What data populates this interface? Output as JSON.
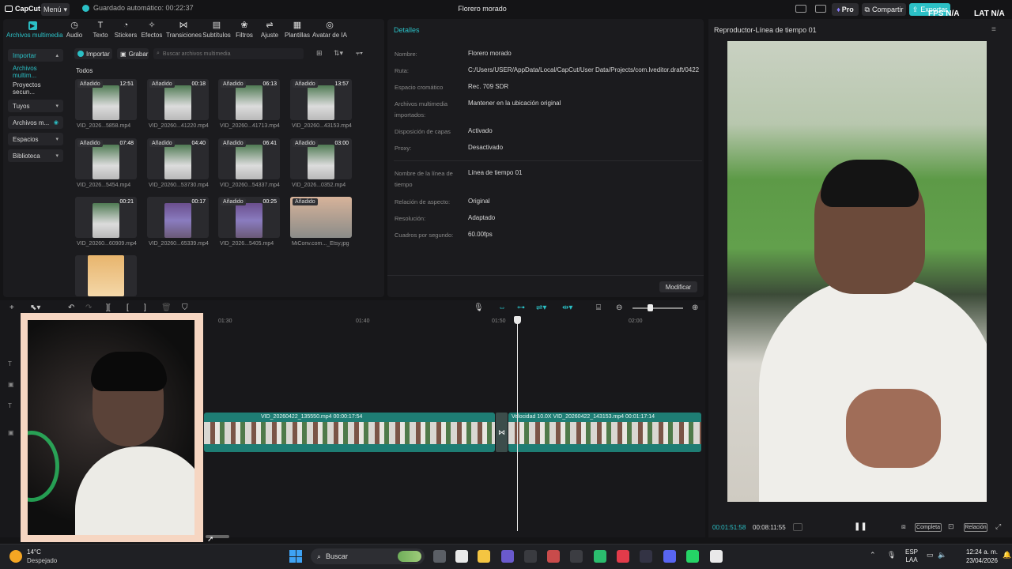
{
  "topbar": {
    "logo": "CapCut",
    "menu": "Menú",
    "autosave": "Guardado automático: 00:22:37",
    "project_title": "Florero morado",
    "pro": "Pro",
    "share": "Compartir",
    "export": "Exportar",
    "fps": "FPS N/A",
    "lat": "LAT N/A"
  },
  "toolbar": {
    "tools": [
      "Archivos multimedia",
      "Audio",
      "Texto",
      "Stickers",
      "Efectos",
      "Transiciones",
      "Subtítulos",
      "Filtros",
      "Ajuste",
      "Plantillas",
      "Avatar de IA"
    ],
    "icons": [
      "media-icon",
      "audio-icon",
      "text-icon",
      "stickers-icon",
      "effects-icon",
      "transitions-icon",
      "subtitles-icon",
      "filters-icon",
      "adjust-icon",
      "templates-icon",
      "ai-avatar-icon"
    ]
  },
  "sidebar": {
    "items": [
      "Importar",
      "Archivos multim...",
      "Proyectos secun...",
      "Tuyos",
      "Archivos m...",
      "Espacios",
      "Biblioteca"
    ]
  },
  "media": {
    "import": "Importar",
    "record": "Grabar",
    "search_placeholder": "Buscar archivos multimedia",
    "filter_all": "Todos",
    "items": [
      {
        "badge": "Añadido",
        "duration": "12:51",
        "name": "VID_2026...5858.mp4"
      },
      {
        "badge": "Añadido",
        "duration": "00:18",
        "name": "VID_20260...41220.mp4"
      },
      {
        "badge": "Añadido",
        "duration": "06:13",
        "name": "VID_20260...41713.mp4"
      },
      {
        "badge": "Añadido",
        "duration": "13:57",
        "name": "VID_20260...43153.mp4"
      },
      {
        "badge": "Añadido",
        "duration": "07:48",
        "name": "VID_2026...5454.mp4"
      },
      {
        "badge": "Añadido",
        "duration": "04:40",
        "name": "VID_20260...53730.mp4"
      },
      {
        "badge": "Añadido",
        "duration": "06:41",
        "name": "VID_20260...54337.mp4"
      },
      {
        "badge": "Añadido",
        "duration": "03:00",
        "name": "VID_2026...0352.mp4"
      },
      {
        "badge": "",
        "duration": "00:21",
        "name": "VID_20260...60909.mp4"
      },
      {
        "badge": "",
        "duration": "00:17",
        "name": "VID_20260...65339.mp4"
      },
      {
        "badge": "Añadido",
        "duration": "00:25",
        "name": "VID_2026...5405.mp4"
      },
      {
        "badge": "Añadido",
        "duration": "",
        "name": "MiConv.com..._Etsy.jpg"
      },
      {
        "badge": "",
        "duration": "",
        "name": ""
      }
    ]
  },
  "details": {
    "title": "Detalles",
    "rows": [
      {
        "label": "Nombre:",
        "value": "Florero morado"
      },
      {
        "label": "Ruta:",
        "value": "C:/Users/USER/AppData/Local/CapCut/User Data/Projects/com.lveditor.draft/0422"
      },
      {
        "label": "Espacio cromático",
        "value": "Rec. 709 SDR"
      },
      {
        "label": "Archivos multimedia importados:",
        "value": "Mantener en la ubicación original"
      },
      {
        "label": "Disposición de capas",
        "value": "Activado"
      },
      {
        "label": "Proxy:",
        "value": "Desactivado"
      },
      {
        "label": "Nombre de la línea de tiempo",
        "value": "Línea de tiempo 01"
      },
      {
        "label": "Relación de aspecto:",
        "value": "Original"
      },
      {
        "label": "Resolución:",
        "value": "Adaptado"
      },
      {
        "label": "Cuadros por segundo:",
        "value": "60.00fps"
      }
    ],
    "modify": "Modificar"
  },
  "player": {
    "title": "Reproductor-Línea de tiempo 01",
    "current_time": "00:01:51:58",
    "total_time": "00:08:11:55",
    "full": "Completa",
    "ratio": "Relación"
  },
  "timeline": {
    "ticks": [
      "01:30",
      "01:40",
      "01:50",
      "02:00"
    ],
    "clip1_label": "VID_20260422_135550.mp4  00:00:17:54",
    "clip2_label": "Velocidad 10.0X  VID_20260422_143153.mp4  00:01:17:14"
  },
  "taskbar": {
    "temp": "14°C",
    "weather": "Despejado",
    "search": "Buscar",
    "lang1": "ESP",
    "lang2": "LAA",
    "time": "12:24 a. m.",
    "date": "23/04/2026"
  },
  "colors": {
    "accent": "#2bc0c6",
    "clip": "#1e7d74",
    "panel": "#1b1b1e"
  }
}
